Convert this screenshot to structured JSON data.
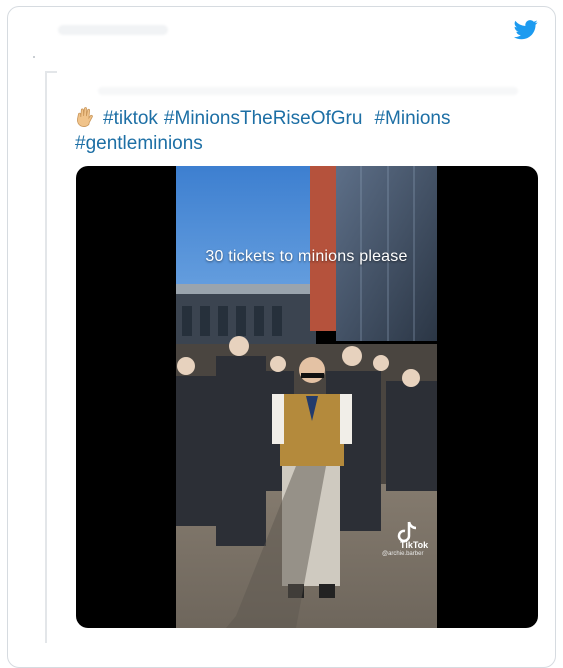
{
  "tweet": {
    "hashtags": [
      "#tiktok",
      "#MinionsTheRiseOfGru",
      "#Minions",
      "#gentleminions"
    ],
    "emoji": "waving-hand"
  },
  "video": {
    "caption": "30 tickets to minions please",
    "watermark_brand": "TikTok",
    "watermark_user": "@archie.barber"
  },
  "icons": {
    "twitter": "twitter-bird-icon",
    "hand": "waving-hand-icon"
  },
  "colors": {
    "link": "#1d6fa5",
    "twitter_blue": "#1d9bf0",
    "card_border": "#d6dbe0"
  }
}
